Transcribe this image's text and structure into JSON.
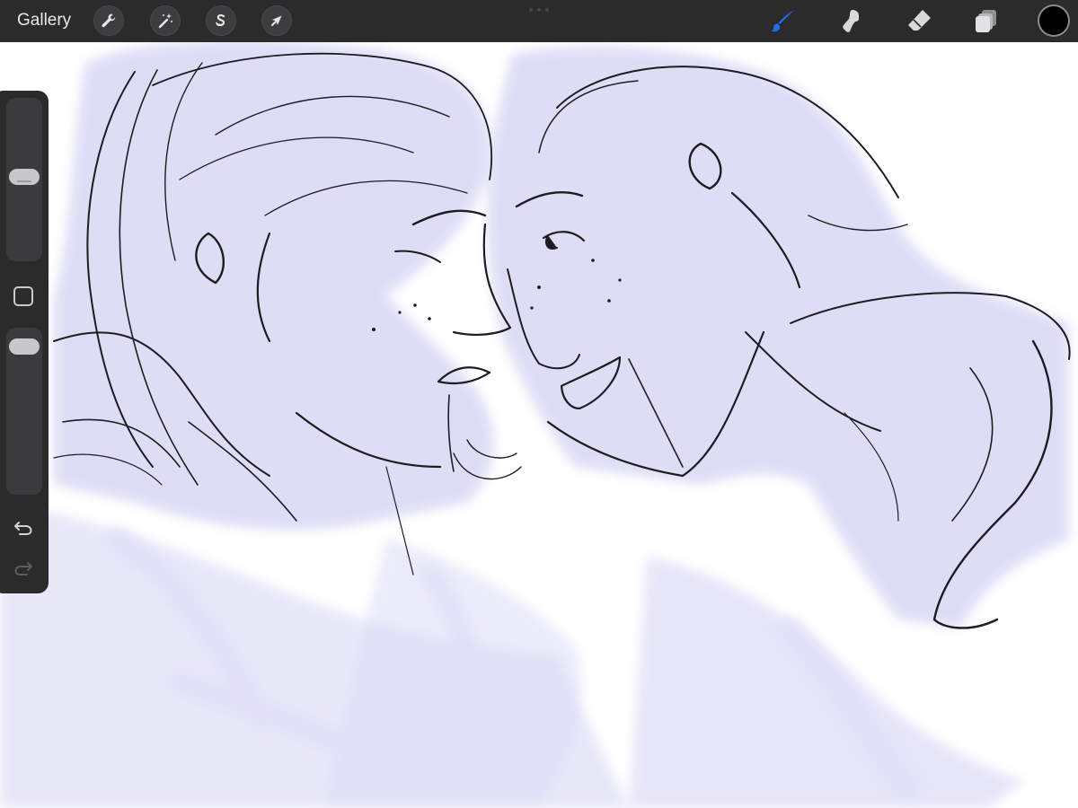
{
  "toolbar": {
    "gallery_label": "Gallery",
    "left_tools": [
      {
        "name": "actions",
        "icon": "wrench-icon"
      },
      {
        "name": "adjustments",
        "icon": "magic-wand-icon"
      },
      {
        "name": "selection",
        "icon": "selection-icon"
      },
      {
        "name": "transform",
        "icon": "arrow-cursor-icon"
      }
    ],
    "right_tools": [
      {
        "name": "brush",
        "icon": "brush-icon",
        "active": true
      },
      {
        "name": "smudge",
        "icon": "smudge-icon",
        "active": false
      },
      {
        "name": "eraser",
        "icon": "eraser-icon",
        "active": false
      },
      {
        "name": "layers",
        "icon": "layers-icon",
        "active": false
      }
    ],
    "current_color": "#000000",
    "active_tool_color": "#1a6ff2"
  },
  "sidebar": {
    "brush_size_fraction": 0.52,
    "opacity_fraction": 0.96,
    "buttons": [
      "modify-button",
      "undo-icon",
      "redo-icon"
    ]
  },
  "canvas": {
    "background": "#ffffff",
    "underpaint_color": "#d8d6f3",
    "line_color": "#1c1c22"
  }
}
